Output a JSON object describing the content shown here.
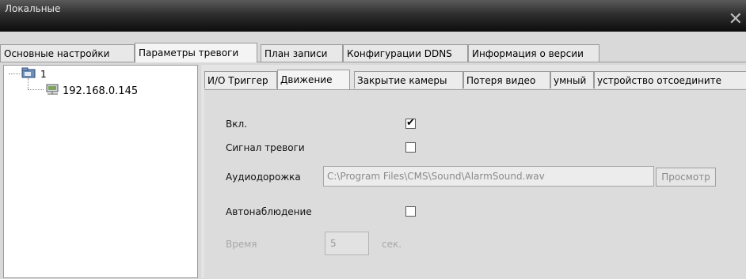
{
  "window": {
    "title": "Локальные",
    "close_glyph": "✕"
  },
  "main_tabs": [
    {
      "label": "Основные настройки",
      "active": false
    },
    {
      "label": "Параметры тревоги",
      "active": true
    },
    {
      "label": "План записи",
      "active": false
    },
    {
      "label": "Конфигурации DDNS",
      "active": false
    },
    {
      "label": "Информация о версии",
      "active": false
    }
  ],
  "tree": {
    "root": {
      "label": "1",
      "icon": "folder-icon"
    },
    "child": {
      "label": "192.168.0.145",
      "icon": "network-device-icon"
    }
  },
  "sub_tabs": [
    {
      "label": "И/О Триггер",
      "active": false
    },
    {
      "label": "Движение",
      "active": true
    },
    {
      "label": "Закрытие камеры",
      "active": false
    },
    {
      "label": "Потеря видео",
      "active": false
    },
    {
      "label": "умный",
      "active": false
    },
    {
      "label": "устройство отсоедините",
      "active": false
    }
  ],
  "form": {
    "enable": {
      "label": "Вкл.",
      "checked": true,
      "mark": "✔"
    },
    "alarm_signal": {
      "label": "Сигнал тревоги",
      "checked": false
    },
    "audio_track": {
      "label": "Аудиодорожка",
      "value": "C:\\Program Files\\CMS\\Sound\\AlarmSound.wav",
      "browse_label": "Просмотр"
    },
    "auto_watch": {
      "label": "Автонаблюдение",
      "checked": false
    },
    "time": {
      "label": "Время",
      "value": "5",
      "unit": "сек."
    }
  }
}
